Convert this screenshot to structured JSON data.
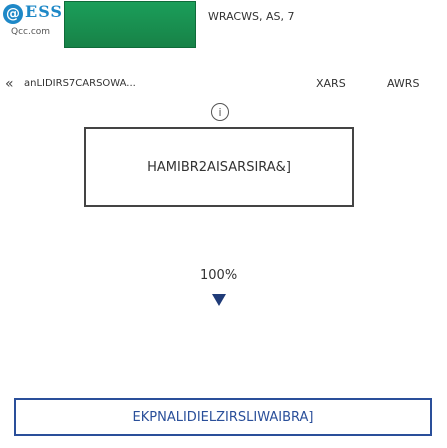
{
  "header": {
    "logo_glyph": "@",
    "logo_mark": "ESS",
    "logo_domain": "Qcc.com",
    "banner_image_text": "",
    "banner_ad_text": "WRACWS, AS, 7"
  },
  "nav": {
    "back_glyph": "«",
    "page_title_truncated": "anLIDIRS7CARSOWA...",
    "tab_a": "XARS",
    "tab_b": "AWRS"
  },
  "content": {
    "info_glyph": "i",
    "title_box_text": "HAMIBR2AISARSIRA&]",
    "zoom_level": "100%",
    "bottom_link_text": "EKPNALIDIELZIRSLIWAIBRA]"
  },
  "colors": {
    "brand_blue": "#1e88c7",
    "banner_green": "#1b9e5a",
    "link_blue": "#2a4f9a",
    "arrow_navy": "#1f3b78"
  }
}
